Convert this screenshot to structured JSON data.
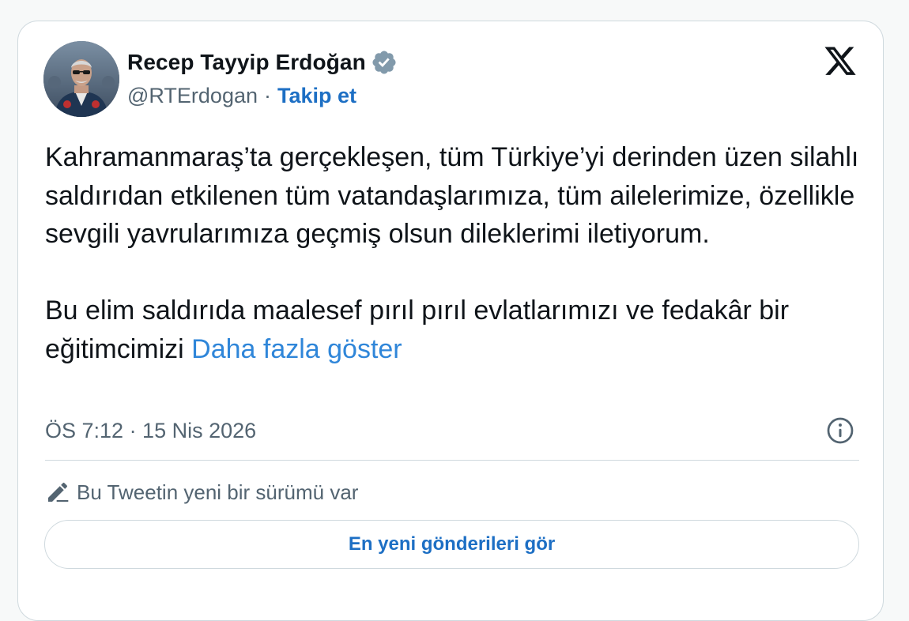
{
  "author": {
    "name": "Recep Tayyip Erdoğan",
    "handle": "@RTErdogan",
    "separator": "·",
    "follow_label": "Takip et",
    "verified_color": "#829aab"
  },
  "tweet": {
    "paragraph1": "Kahramanmaraş’ta gerçekleşen, tüm Türkiye’yi derinden üzen silahlı saldırıdan etkilenen tüm vatandaşlarımıza, tüm ailelerimize, özellikle sevgili yavrularımıza geçmiş olsun dileklerimi iletiyorum.",
    "paragraph2": "Bu elim saldırıda maalesef pırıl pırıl evlatlarımızı ve fedakâr bir eğitimcimizi",
    "show_more": "Daha fazla göster",
    "timestamp": "ÖS 7:12 · 15 Nis 2026"
  },
  "edit_notice": {
    "text": "Bu Tweetin yeni bir sürümü var"
  },
  "latest_button": {
    "label": "En yeni gönderileri gör"
  },
  "icons": {
    "verified": "verified-badge-icon",
    "x_logo": "x-logo-icon",
    "info": "info-icon",
    "pencil": "pencil-icon"
  },
  "colors": {
    "link": "#1d6fc4",
    "show_more": "#2f86d9",
    "secondary_text": "#536471",
    "border": "#cfd9de"
  }
}
